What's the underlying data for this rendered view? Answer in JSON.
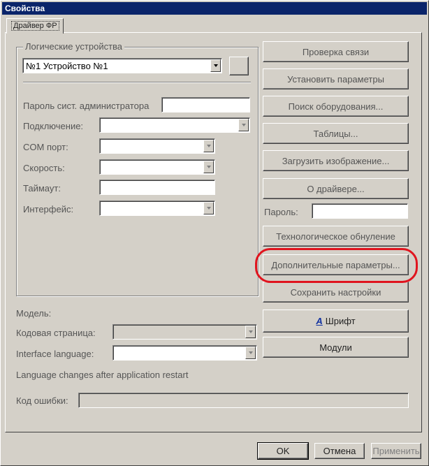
{
  "window": {
    "title": "Свойства"
  },
  "tab": {
    "label": "Драйвер ФР"
  },
  "logical_devices": {
    "group_label": "Логические устройства",
    "selected_device": "№1 Устройство №1"
  },
  "form": {
    "password_label": "Пароль сист. администратора",
    "connection_label": "Подключение:",
    "com_port_label": "COM порт:",
    "speed_label": "Скорость:",
    "timeout_label": "Таймаут:",
    "interface_label": "Интерфейс:"
  },
  "model": {
    "model_label": "Модель:",
    "codepage_label": "Кодовая страница:",
    "interface_language_label": "Interface language:",
    "restart_note": "Language changes after application restart",
    "error_code_label": "Код ошибки:"
  },
  "buttons": {
    "check_connection": "Проверка связи",
    "set_parameters": "Установить параметры",
    "search_equipment": "Поиск оборудования...",
    "tables": "Таблицы...",
    "load_image": "Загрузить изображение...",
    "about_driver": "О драйвере...",
    "password_label": "Пароль:",
    "tech_reset": "Технологическое обнуление",
    "additional_params": "Дополнительные параметры...",
    "save_settings": "Сохранить настройки",
    "font": "Шрифт",
    "modules": "Модули"
  },
  "dialog_buttons": {
    "ok": "OK",
    "cancel": "Отмена",
    "apply": "Применить"
  },
  "colors": {
    "titlebar": "#0a246a",
    "highlight": "#e0141e",
    "face": "#d4d0c8"
  }
}
